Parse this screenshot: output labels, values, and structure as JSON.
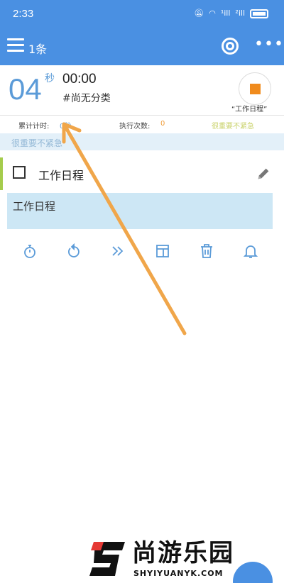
{
  "status_bar": {
    "time": "2:33",
    "signal_1": "¹ill",
    "signal_2": "²ill"
  },
  "app_bar": {
    "title": "1条"
  },
  "timer": {
    "big_value": "04",
    "big_unit": "秒",
    "clock": "00:00",
    "category": "#尚无分类",
    "stop_label": "“工作日程”"
  },
  "stats": {
    "total_label": "累计计时:",
    "total_value": "0秒",
    "count_label": "执行次数:",
    "count_value": "0",
    "priority_label": "很重要不紧急"
  },
  "priority_header": "很重要不紧急",
  "task": {
    "title": "工作日程"
  },
  "note": {
    "text": "工作日程"
  },
  "toolbar": {
    "icons": [
      "stopwatch-icon",
      "restart-icon",
      "skip-forward-icon",
      "layout-icon",
      "trash-icon",
      "bell-icon"
    ]
  },
  "colors": {
    "primary": "#4a90e2",
    "accent_orange": "#f08b1d",
    "task_accent": "#a5cc4c",
    "note_bg": "#cde7f5",
    "arrow": "#f0a64a"
  },
  "watermark": {
    "text": "尚游乐园",
    "domain": "SHYIYUANYK.COM"
  }
}
